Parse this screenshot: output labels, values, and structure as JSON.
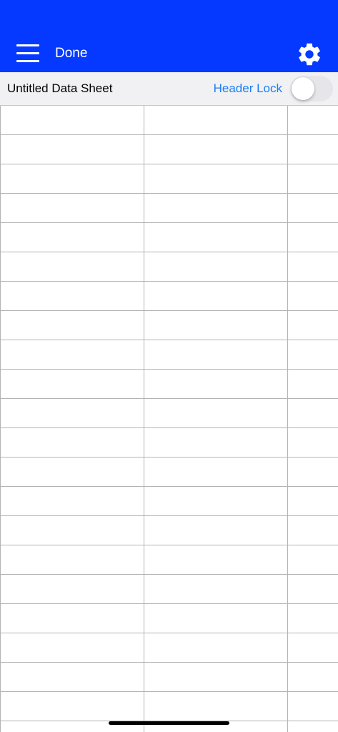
{
  "toolbar": {
    "done_label": "Done",
    "menu_icon": "hamburger-menu-icon",
    "settings_icon": "gear-icon",
    "background_color": "#0539ff"
  },
  "sheet": {
    "title": "Untitled Data Sheet",
    "header_lock_label": "Header Lock",
    "header_lock_on": false,
    "accent_color": "#1a7ef5"
  },
  "grid": {
    "row_count": 22,
    "column_count": 3
  }
}
